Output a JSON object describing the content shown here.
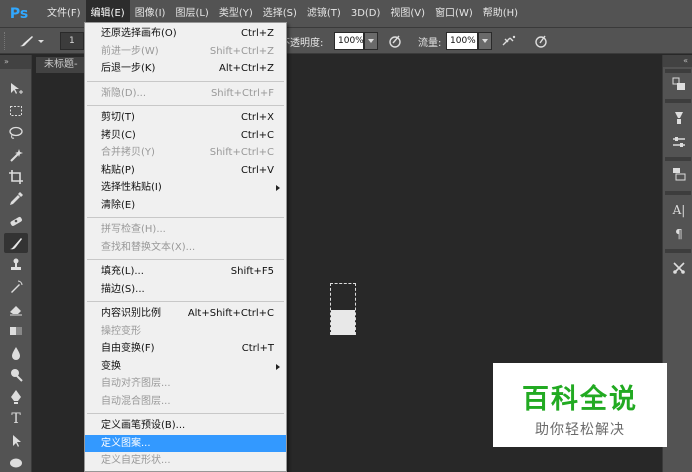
{
  "app": {
    "logo": "Ps"
  },
  "menubar": {
    "items": [
      "文件(F)",
      "编辑(E)",
      "图像(I)",
      "图层(L)",
      "类型(Y)",
      "选择(S)",
      "滤镜(T)",
      "3D(D)",
      "视图(V)",
      "窗口(W)",
      "帮助(H)"
    ]
  },
  "options": {
    "brush_size": "1",
    "opacity_label": "不透明度:",
    "opacity_value": "100%",
    "flow_label": "流量:",
    "flow_value": "100%"
  },
  "document": {
    "tab_title": "未标题-"
  },
  "edit_menu": {
    "items": [
      {
        "label": "还原选择画布(O)",
        "shortcut": "Ctrl+Z"
      },
      {
        "label": "前进一步(W)",
        "shortcut": "Shift+Ctrl+Z"
      },
      {
        "label": "后退一步(K)",
        "shortcut": "Alt+Ctrl+Z"
      },
      {
        "label": "渐隐(D)...",
        "shortcut": "Shift+Ctrl+F"
      },
      {
        "label": "剪切(T)",
        "shortcut": "Ctrl+X"
      },
      {
        "label": "拷贝(C)",
        "shortcut": "Ctrl+C"
      },
      {
        "label": "合并拷贝(Y)",
        "shortcut": "Shift+Ctrl+C"
      },
      {
        "label": "粘贴(P)",
        "shortcut": "Ctrl+V"
      },
      {
        "label": "选择性粘贴(I)",
        "shortcut": ""
      },
      {
        "label": "清除(E)",
        "shortcut": ""
      },
      {
        "label": "拼写检查(H)...",
        "shortcut": ""
      },
      {
        "label": "查找和替换文本(X)...",
        "shortcut": ""
      },
      {
        "label": "填充(L)...",
        "shortcut": "Shift+F5"
      },
      {
        "label": "描边(S)...",
        "shortcut": ""
      },
      {
        "label": "内容识别比例",
        "shortcut": "Alt+Shift+Ctrl+C"
      },
      {
        "label": "操控变形",
        "shortcut": ""
      },
      {
        "label": "自由变换(F)",
        "shortcut": "Ctrl+T"
      },
      {
        "label": "变换",
        "shortcut": ""
      },
      {
        "label": "自动对齐图层...",
        "shortcut": ""
      },
      {
        "label": "自动混合图层...",
        "shortcut": ""
      },
      {
        "label": "定义画笔预设(B)...",
        "shortcut": ""
      },
      {
        "label": "定义图案...",
        "shortcut": ""
      },
      {
        "label": "定义自定形状...",
        "shortcut": ""
      }
    ]
  },
  "watermark": {
    "title": "百科全说",
    "subtitle": "助你轻松解决"
  },
  "colors": {
    "highlight": "#3399ff",
    "panel": "#535353",
    "canvas": "#282828",
    "brand": "#22aa22"
  }
}
